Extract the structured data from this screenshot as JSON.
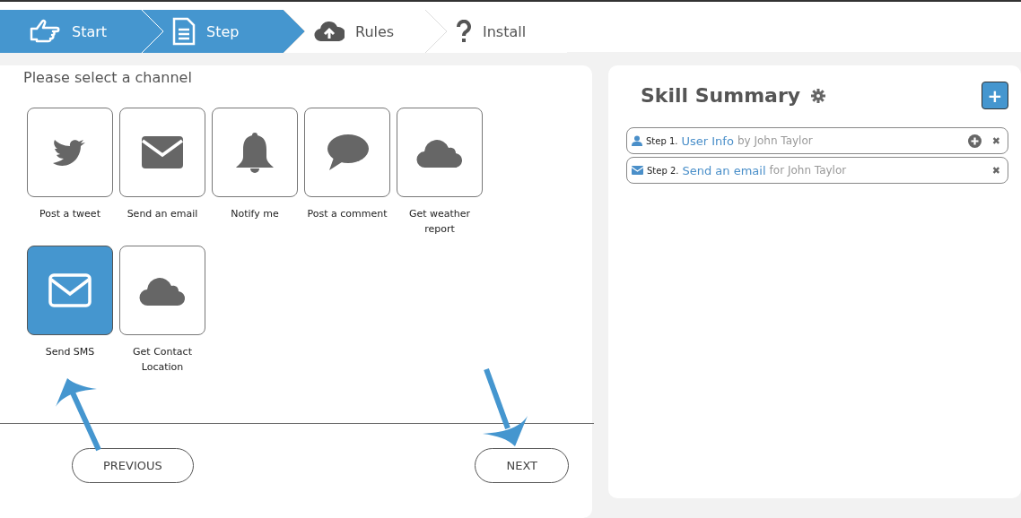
{
  "wizard": [
    {
      "label": "Start",
      "kind": "hand",
      "active": true
    },
    {
      "label": "Step",
      "kind": "document",
      "active": true
    },
    {
      "label": "Rules",
      "kind": "upload",
      "active": false
    },
    {
      "label": "Install",
      "kind": "help",
      "active": false
    }
  ],
  "channel_panel": {
    "prompt": "Please select a channel",
    "channels": [
      {
        "label": "Post a tweet",
        "kind": "tweet",
        "selected": false
      },
      {
        "label": "Send an email",
        "kind": "email",
        "selected": false
      },
      {
        "label": "Notify me",
        "kind": "notify",
        "selected": false
      },
      {
        "label": "Post a comment",
        "kind": "comment",
        "selected": false
      },
      {
        "label": "Get weather report",
        "kind": "weather",
        "selected": false
      },
      {
        "label": "Send SMS",
        "kind": "email",
        "selected": true
      },
      {
        "label": "Get Contact Location",
        "kind": "weather",
        "selected": false
      }
    ],
    "buttons": [
      "PREVIOUS",
      "NEXT"
    ]
  },
  "summary": {
    "title": "Skill Summary",
    "add_button": "+",
    "steps": [
      {
        "kind": "user",
        "step": "Step 1.",
        "name": "User Info",
        "by": "by John Taylor",
        "can_add": true,
        "remove": "✖"
      },
      {
        "kind": "email",
        "step": "Step 2.",
        "name": "Send an email",
        "by": "for John Taylor",
        "can_add": false,
        "remove": "✖"
      }
    ]
  }
}
